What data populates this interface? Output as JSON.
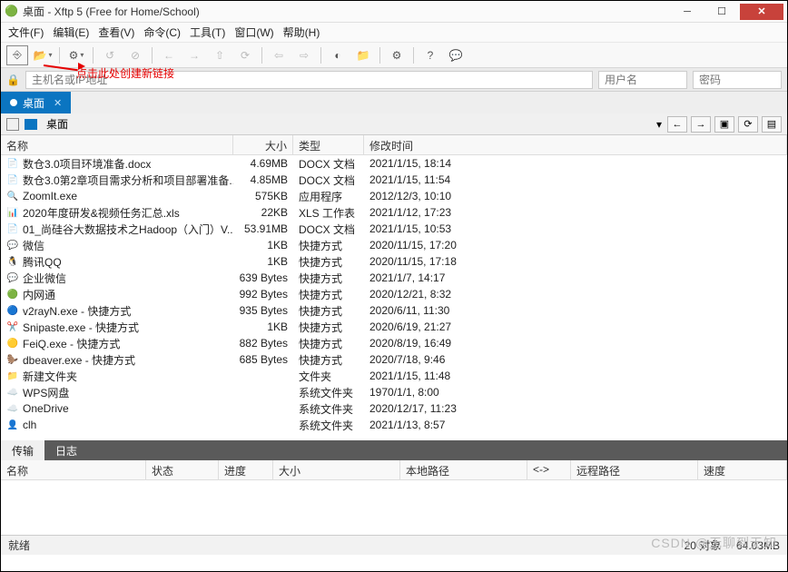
{
  "window": {
    "title": "桌面   - Xftp 5 (Free for Home/School)"
  },
  "menus": [
    "文件(F)",
    "编辑(E)",
    "查看(V)",
    "命令(C)",
    "工具(T)",
    "窗口(W)",
    "帮助(H)"
  ],
  "annotation": "点击此处创建新链接",
  "address": {
    "hostPlaceholder": "主机名或IP地址",
    "userPlaceholder": "用户名",
    "passPlaceholder": "密码"
  },
  "tab": {
    "label": "桌面"
  },
  "path": {
    "label": "桌面"
  },
  "columns": {
    "name": "名称",
    "size": "大小",
    "type": "类型",
    "modified": "修改时间"
  },
  "files": [
    {
      "ico": "📄",
      "name": "数仓3.0项目环境准备.docx",
      "size": "4.69MB",
      "type": "DOCX 文档",
      "date": "2021/1/15, 18:14"
    },
    {
      "ico": "📄",
      "name": "数仓3.0第2章项目需求分析和项目部署准备...",
      "size": "4.85MB",
      "type": "DOCX 文档",
      "date": "2021/1/15, 11:54"
    },
    {
      "ico": "🔍",
      "name": "ZoomIt.exe",
      "size": "575KB",
      "type": "应用程序",
      "date": "2012/12/3, 10:10"
    },
    {
      "ico": "📊",
      "name": "2020年度研发&视频任务汇总.xls",
      "size": "22KB",
      "type": "XLS 工作表",
      "date": "2021/1/12, 17:23"
    },
    {
      "ico": "📄",
      "name": "01_尚硅谷大数据技术之Hadoop（入门）V...",
      "size": "53.91MB",
      "type": "DOCX 文档",
      "date": "2021/1/15, 10:53"
    },
    {
      "ico": "💬",
      "name": "微信",
      "size": "1KB",
      "type": "快捷方式",
      "date": "2020/11/15, 17:20"
    },
    {
      "ico": "🐧",
      "name": "腾讯QQ",
      "size": "1KB",
      "type": "快捷方式",
      "date": "2020/11/15, 17:18"
    },
    {
      "ico": "💬",
      "name": "企业微信",
      "size": "639 Bytes",
      "type": "快捷方式",
      "date": "2021/1/7, 14:17"
    },
    {
      "ico": "🟢",
      "name": "内网通",
      "size": "992 Bytes",
      "type": "快捷方式",
      "date": "2020/12/21, 8:32"
    },
    {
      "ico": "🔵",
      "name": "v2rayN.exe - 快捷方式",
      "size": "935 Bytes",
      "type": "快捷方式",
      "date": "2020/6/11, 11:30"
    },
    {
      "ico": "✂️",
      "name": "Snipaste.exe - 快捷方式",
      "size": "1KB",
      "type": "快捷方式",
      "date": "2020/6/19, 21:27"
    },
    {
      "ico": "🟡",
      "name": "FeiQ.exe - 快捷方式",
      "size": "882 Bytes",
      "type": "快捷方式",
      "date": "2020/8/19, 16:49"
    },
    {
      "ico": "🦫",
      "name": "dbeaver.exe - 快捷方式",
      "size": "685 Bytes",
      "type": "快捷方式",
      "date": "2020/7/18, 9:46"
    },
    {
      "ico": "📁",
      "name": "新建文件夹",
      "size": "",
      "type": "文件夹",
      "date": "2021/1/15, 11:48"
    },
    {
      "ico": "☁️",
      "name": "WPS网盘",
      "size": "",
      "type": "系统文件夹",
      "date": "1970/1/1, 8:00"
    },
    {
      "ico": "☁️",
      "name": "OneDrive",
      "size": "",
      "type": "系统文件夹",
      "date": "2020/12/17, 11:23"
    },
    {
      "ico": "👤",
      "name": "clh",
      "size": "",
      "type": "系统文件夹",
      "date": "2021/1/13, 8:57"
    }
  ],
  "xferTabs": {
    "transfer": "传输",
    "log": "日志"
  },
  "xferCols": {
    "name": "名称",
    "status": "状态",
    "progress": "进度",
    "size": "大小",
    "local": "本地路径",
    "arrow": "<->",
    "remote": "远程路径",
    "speed": "速度"
  },
  "status": {
    "ready": "就绪",
    "objects": "20 对象",
    "size": "64.03MB"
  },
  "watermark": "CSDN @无聊到无知"
}
